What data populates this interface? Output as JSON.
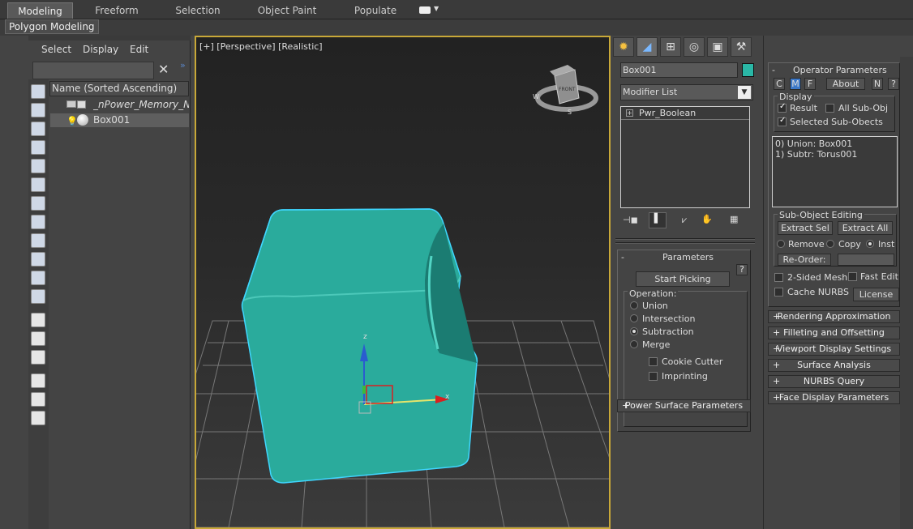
{
  "ribbon": {
    "tabs": [
      "Modeling",
      "Freeform",
      "Selection",
      "Object Paint",
      "Populate"
    ],
    "active_tab": "Modeling",
    "sub_label": "Polygon Modeling"
  },
  "explorer": {
    "menu": [
      "Select",
      "Display",
      "Edit"
    ],
    "search_value": "",
    "column_header": "Name (Sorted Ascending)",
    "rows": [
      {
        "label": "_nPower_Memory_Node",
        "selected": false
      },
      {
        "label": "Box001",
        "selected": true
      }
    ],
    "left_icons": [
      "geometry-icon",
      "shapes-icon",
      "lights-icon",
      "cameras-icon",
      "helpers-icon",
      "spacewarps-icon",
      "groups-icon",
      "object-xrefs-icon",
      "bones-icon",
      "containers-icon",
      "frozen-icon",
      "hidden-icon",
      "display-all-icon",
      "display-none-icon",
      "invert-display-icon",
      "filter-icon",
      "filter-selected-icon",
      "layer-icon"
    ]
  },
  "viewport": {
    "label": "[+] [Perspective] [Realistic]",
    "viewcube_face": "FRONT",
    "compass": [
      "W",
      "S"
    ],
    "axes": {
      "x": "x",
      "z": "z"
    },
    "object_color": "#2aab9c"
  },
  "command_panel": {
    "tab_icons": [
      "create-icon",
      "modify-icon",
      "hierarchy-icon",
      "motion-icon",
      "display-icon",
      "utilities-icon"
    ],
    "object_name": "Box001",
    "object_color": "#2ab7a6",
    "modifier_list": "Modifier List",
    "stack_item": "Pwr_Boolean",
    "parameters": {
      "title": "Parameters",
      "help": "?",
      "start_picking": "Start Picking",
      "operation_label": "Operation:",
      "operations": [
        "Union",
        "Intersection",
        "Subtraction",
        "Merge"
      ],
      "selected_operation": "Subtraction",
      "cookie_cutter": "Cookie Cutter",
      "imprinting": "Imprinting"
    },
    "power_surface_rollout": "Power Surface Parameters"
  },
  "operator_panel": {
    "title": "Operator Parameters",
    "buttons": {
      "c": "C",
      "m": "M",
      "f": "F",
      "about": "About",
      "n": "N",
      "help": "?"
    },
    "display_label": "Display",
    "result": "Result",
    "all_sub_obj": "All Sub-Obj",
    "selected_sub_objects": "Selected Sub-Obects",
    "operands": [
      "0) Union: Box001",
      "1) Subtr: Torus001"
    ],
    "sub_object_editing": "Sub-Object Editing",
    "extract_sel": "Extract Sel",
    "extract_all": "Extract All",
    "remove": "Remove",
    "copy": "Copy",
    "inst": "Inst",
    "reorder": "Re-Order:",
    "two_sided_mesh": "2-Sided Mesh",
    "fast_edit": "Fast Edit",
    "cache_nurbs": "Cache NURBS",
    "license": "License",
    "rollouts": [
      "Rendering Approximation",
      "Filleting and Offsetting",
      "Viewport Display Settings",
      "Surface Analysis",
      "NURBS Query",
      "Face Display Parameters"
    ]
  }
}
